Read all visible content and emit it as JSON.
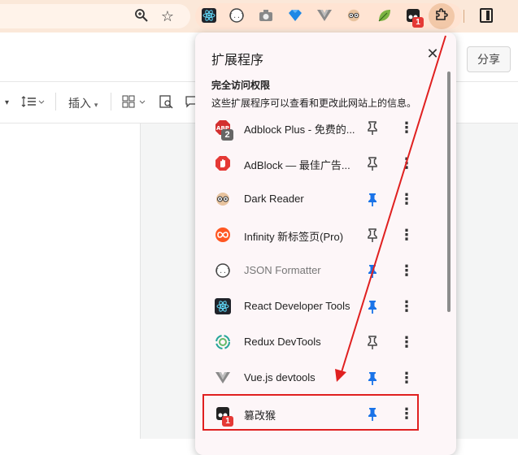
{
  "toolbar": {
    "zoom_icon": "zoom-icon",
    "star_icon": "star-icon",
    "extension_badge": "1",
    "puzzle_icon": "puzzle-icon",
    "sidepanel_icon": "sidepanel-icon"
  },
  "document": {
    "share_label": "分享",
    "toolbar_insert": "插入"
  },
  "popup": {
    "title": "扩展程序",
    "close": "✕",
    "section_title": "完全访问权限",
    "section_desc": "这些扩展程序可以查看和更改此网站上的信息。",
    "items": [
      {
        "name": "Adblock Plus - 免费的...",
        "icon": "adblock-plus-icon",
        "badge": "2",
        "pinned": false
      },
      {
        "name": "AdBlock — 最佳广告...",
        "icon": "adblock-icon",
        "pinned": false
      },
      {
        "name": "Dark Reader",
        "icon": "dark-reader-icon",
        "pinned": true
      },
      {
        "name": "Infinity 新标签页(Pro)",
        "icon": "infinity-icon",
        "pinned": false
      },
      {
        "name": "JSON Formatter",
        "icon": "json-formatter-icon",
        "pinned": true
      },
      {
        "name": "React Developer Tools",
        "icon": "react-icon",
        "pinned": true
      },
      {
        "name": "Redux DevTools",
        "icon": "redux-icon",
        "pinned": false
      },
      {
        "name": "Vue.js devtools",
        "icon": "vue-icon",
        "pinned": true
      },
      {
        "name": "篡改猴",
        "icon": "tampermonkey-icon",
        "badge": "1",
        "pinned": true
      }
    ]
  },
  "colors": {
    "accent_pin": "#1a73e8",
    "annotation_red": "#e02020"
  }
}
